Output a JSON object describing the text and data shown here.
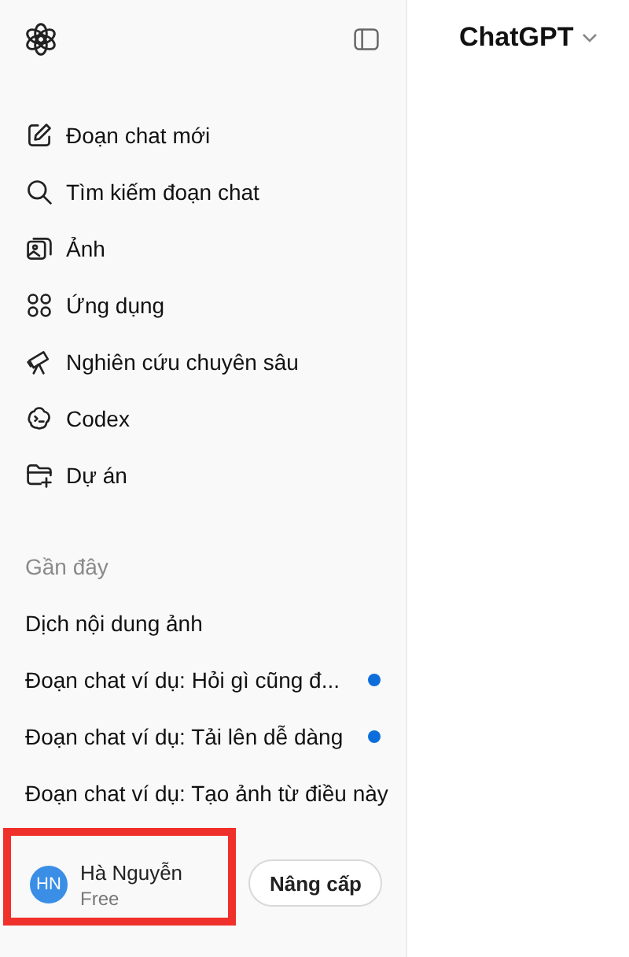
{
  "sidebar": {
    "nav_items": [
      {
        "label": "Đoạn chat mới",
        "kind": "new-chat"
      },
      {
        "label": "Tìm kiếm đoạn chat",
        "kind": "search"
      },
      {
        "label": "Ảnh",
        "kind": "images"
      },
      {
        "label": "Ứng dụng",
        "kind": "apps"
      },
      {
        "label": "Nghiên cứu chuyên sâu",
        "kind": "research"
      },
      {
        "label": "Codex",
        "kind": "codex"
      },
      {
        "label": "Dự án",
        "kind": "projects"
      }
    ],
    "section_title": "Gần đây",
    "recent_chats": [
      {
        "title": "Dịch nội dung ảnh",
        "unread": false
      },
      {
        "title": "Đoạn chat ví dụ: Hỏi gì cũng đ...",
        "unread": true
      },
      {
        "title": "Đoạn chat ví dụ: Tải lên dễ dàng",
        "unread": true
      },
      {
        "title": "Đoạn chat ví dụ: Tạo ảnh từ điều này",
        "unread": false
      }
    ],
    "profile": {
      "initials": "HN",
      "name": "Hà Nguyễn",
      "plan": "Free",
      "highlighted": true
    },
    "upgrade_button": "Nâng cấp"
  },
  "header": {
    "model": "ChatGPT"
  }
}
